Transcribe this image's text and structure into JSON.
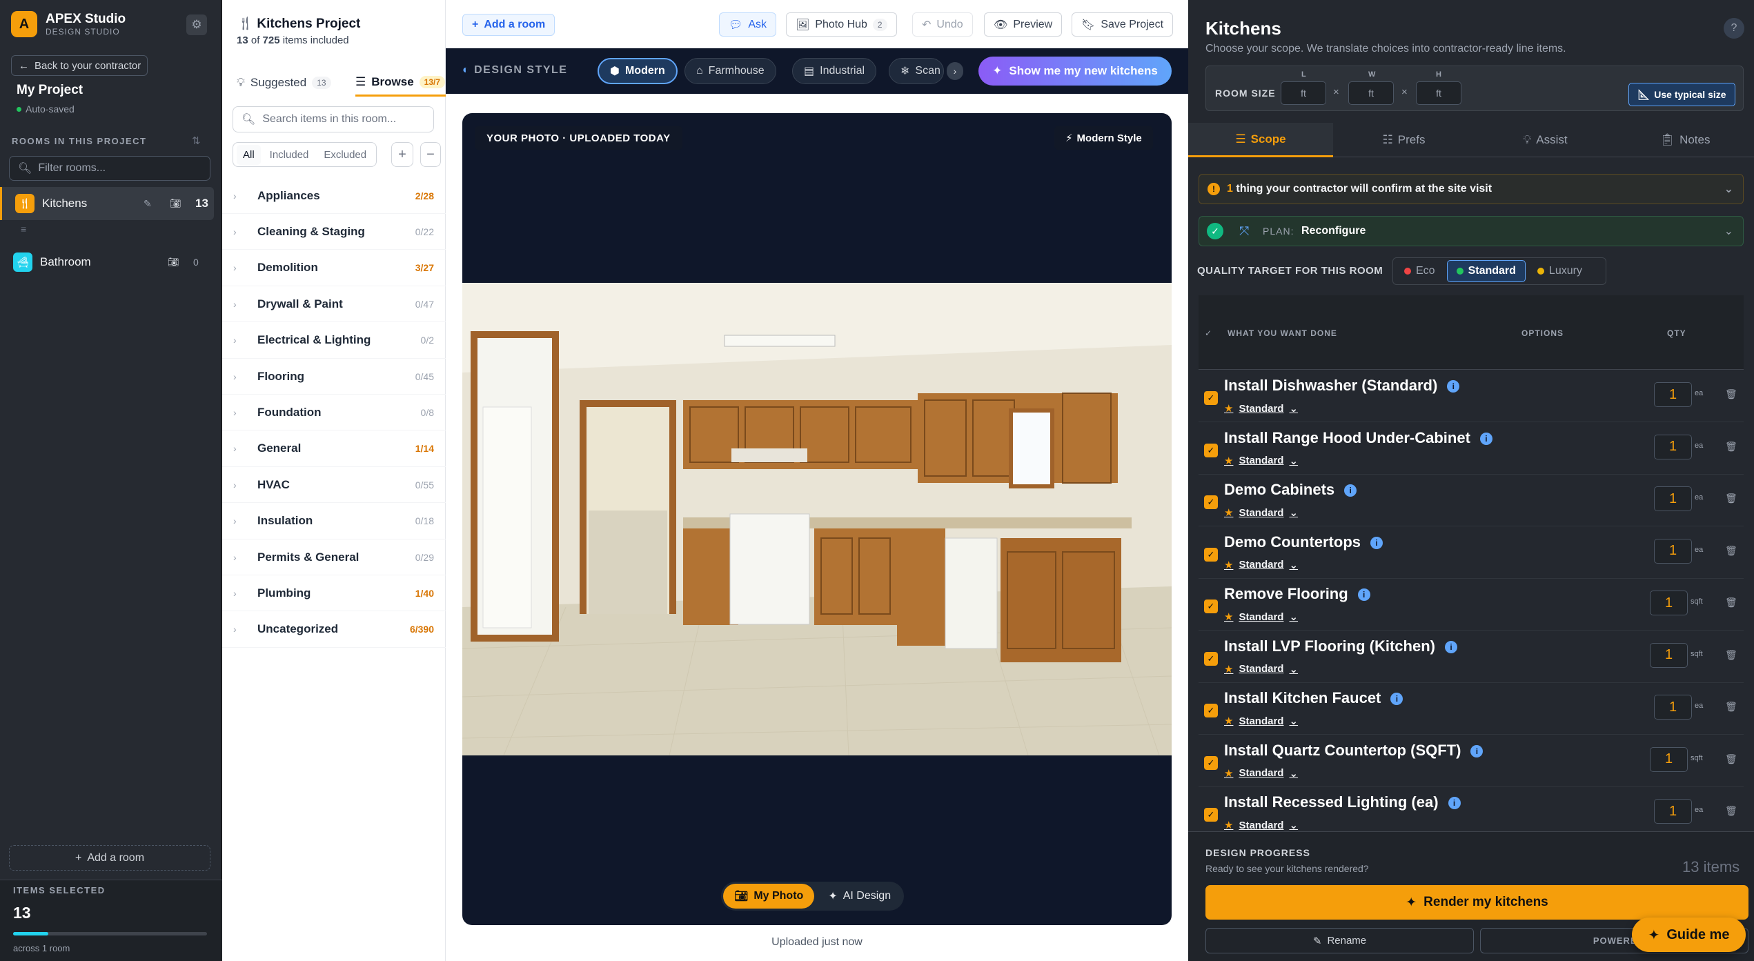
{
  "sidebar": {
    "logo_letter": "A",
    "brand": "APEX Studio",
    "brand_sub": "DESIGN STUDIO",
    "back_label": "Back to your contractor",
    "project_title": "My Project",
    "autosave": "Auto-saved",
    "rooms_label": "ROOMS IN THIS PROJECT",
    "filter_placeholder": "Filter rooms...",
    "rooms": [
      {
        "name": "Kitchens",
        "count": "13",
        "color": "#f59e0b",
        "icon": "fork-knife-icon"
      },
      {
        "name": "Bathroom",
        "count": "0",
        "color": "#22d3ee",
        "icon": "bath-icon"
      }
    ],
    "add_room": "Add a room",
    "items_selected_label": "ITEMS SELECTED",
    "items_selected": "13",
    "items_progress": 0.18,
    "items_sub": "across 1 room"
  },
  "browse": {
    "title": "Kitchens Project",
    "included": "13",
    "total": "725",
    "sub_suffix": "items included",
    "sub_of": "of",
    "tab_suggested": "Suggested",
    "tab_suggested_count": "13",
    "tab_browse": "Browse",
    "tab_browse_count": "13/7",
    "search_placeholder": "Search items in this room...",
    "filter_all": "All",
    "filter_included": "Included",
    "filter_excluded": "Excluded",
    "categories": [
      {
        "name": "Appliances",
        "count": "2/28",
        "hi": true
      },
      {
        "name": "Cleaning & Staging",
        "count": "0/22",
        "hi": false
      },
      {
        "name": "Demolition",
        "count": "3/27",
        "hi": true
      },
      {
        "name": "Drywall & Paint",
        "count": "0/47",
        "hi": false
      },
      {
        "name": "Electrical & Lighting",
        "count": "0/2",
        "hi": false
      },
      {
        "name": "Flooring",
        "count": "0/45",
        "hi": false
      },
      {
        "name": "Foundation",
        "count": "0/8",
        "hi": false
      },
      {
        "name": "General",
        "count": "1/14",
        "hi": true
      },
      {
        "name": "HVAC",
        "count": "0/55",
        "hi": false
      },
      {
        "name": "Insulation",
        "count": "0/18",
        "hi": false
      },
      {
        "name": "Permits & General",
        "count": "0/29",
        "hi": false
      },
      {
        "name": "Plumbing",
        "count": "1/40",
        "hi": true
      },
      {
        "name": "Uncategorized",
        "count": "6/390",
        "hi": true
      }
    ]
  },
  "topbar": {
    "add_room": "Add a room",
    "ask": "Ask",
    "photo_hub": "Photo Hub",
    "photo_hub_count": "2",
    "undo": "Undo",
    "preview": "Preview",
    "save": "Save Project"
  },
  "style": {
    "label": "DESIGN STYLE",
    "chips": [
      "Modern",
      "Farmhouse",
      "Industrial",
      "Scan"
    ],
    "cta": "Show me my new kitchens"
  },
  "canvas": {
    "photo_label": "YOUR PHOTO · UPLOADED TODAY",
    "style_badge": "Modern Style",
    "toggle_photo": "My Photo",
    "toggle_ai": "AI Design",
    "uploaded": "Uploaded just now"
  },
  "panel": {
    "title": "Kitchens",
    "subtitle": "Choose your scope. We translate choices into contractor-ready line items.",
    "room_size": "ROOM SIZE",
    "dims": [
      "L",
      "W",
      "H"
    ],
    "dim_placeholder": "ft",
    "typical": "Use typical size",
    "tabs": [
      "Scope",
      "Prefs",
      "Assist",
      "Notes"
    ],
    "confirm_count": "1",
    "confirm_text": "thing your contractor will confirm at the site visit",
    "plan_label": "PLAN:",
    "plan_value": "Reconfigure",
    "quality_label": "QUALITY TARGET FOR THIS ROOM",
    "quality": [
      {
        "label": "Eco",
        "color": "#ef4444"
      },
      {
        "label": "Standard",
        "color": "#22c55e"
      },
      {
        "label": "Luxury",
        "color": "#eab308"
      }
    ],
    "col_what": "WHAT YOU WANT DONE",
    "col_options": "OPTIONS",
    "col_qty": "QTY",
    "items": [
      {
        "name": "Install Dishwasher (Standard)",
        "tier": "Standard",
        "qty": "1",
        "unit": "ea"
      },
      {
        "name": "Install Range Hood Under-Cabinet",
        "tier": "Standard",
        "qty": "1",
        "unit": "ea"
      },
      {
        "name": "Demo Cabinets",
        "tier": "Standard",
        "qty": "1",
        "unit": "ea"
      },
      {
        "name": "Demo Countertops",
        "tier": "Standard",
        "qty": "1",
        "unit": "ea"
      },
      {
        "name": "Remove Flooring",
        "tier": "Standard",
        "qty": "1",
        "unit": "sqft"
      },
      {
        "name": "Install LVP Flooring (Kitchen)",
        "tier": "Standard",
        "qty": "1",
        "unit": "sqft"
      },
      {
        "name": "Install Kitchen Faucet",
        "tier": "Standard",
        "qty": "1",
        "unit": "ea"
      },
      {
        "name": "Install Quartz Countertop (SQFT)",
        "tier": "Standard",
        "qty": "1",
        "unit": "sqft"
      },
      {
        "name": "Install Recessed Lighting (ea)",
        "tier": "Standard",
        "qty": "1",
        "unit": "ea"
      }
    ],
    "progress_label": "DESIGN PROGRESS",
    "progress_sub": "Ready to see your kitchens rendered?",
    "progress_count": "13 items",
    "render": "Render my kitchens",
    "rename": "Rename",
    "powered": "POWERED",
    "guide": "Guide me"
  }
}
